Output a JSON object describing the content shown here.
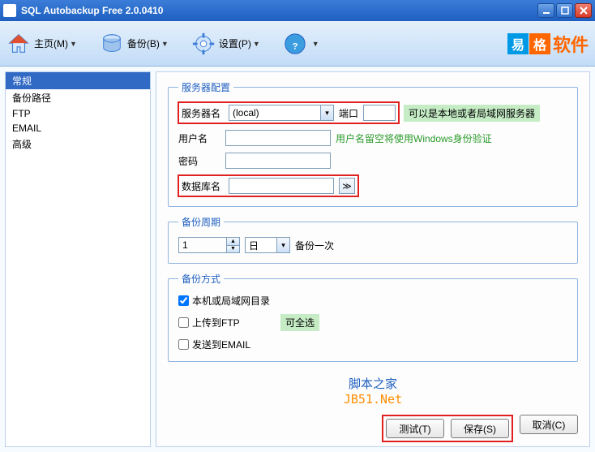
{
  "window": {
    "title": "SQL Autobackup Free 2.0.0410"
  },
  "toolbar": {
    "home": "主页(M)",
    "backup": "备份(B)",
    "settings": "设置(P)",
    "logo": {
      "c1": "易",
      "c2": "格",
      "text": "软件"
    }
  },
  "sidebar": {
    "items": [
      {
        "label": "常规",
        "selected": true
      },
      {
        "label": "备份路径",
        "selected": false
      },
      {
        "label": "FTP",
        "selected": false
      },
      {
        "label": "EMAIL",
        "selected": false
      },
      {
        "label": "高级",
        "selected": false
      }
    ]
  },
  "server": {
    "legend": "服务器配置",
    "name_label": "服务器名",
    "name_value": "(local)",
    "port_label": "端口",
    "port_value": "",
    "hint1": "可以是本地或者局域网服务器",
    "user_label": "用户名",
    "user_value": "",
    "hint2": "用户名留空将使用Windows身份验证",
    "pass_label": "密码",
    "pass_value": "",
    "db_label": "数据库名",
    "db_value": ""
  },
  "period": {
    "legend": "备份周期",
    "value": "1",
    "unit": "日",
    "suffix": "备份一次"
  },
  "method": {
    "legend": "备份方式",
    "opt1": "本机或局域网目录",
    "opt1_checked": true,
    "opt2": "上传到FTP",
    "opt2_checked": false,
    "opt3": "发送到EMAIL",
    "opt3_checked": false,
    "allopt": "可全选"
  },
  "footer": {
    "line1": "脚本之家",
    "line2": "JB51.Net"
  },
  "buttons": {
    "test": "测试(T)",
    "save": "保存(S)",
    "cancel": "取消(C)"
  }
}
